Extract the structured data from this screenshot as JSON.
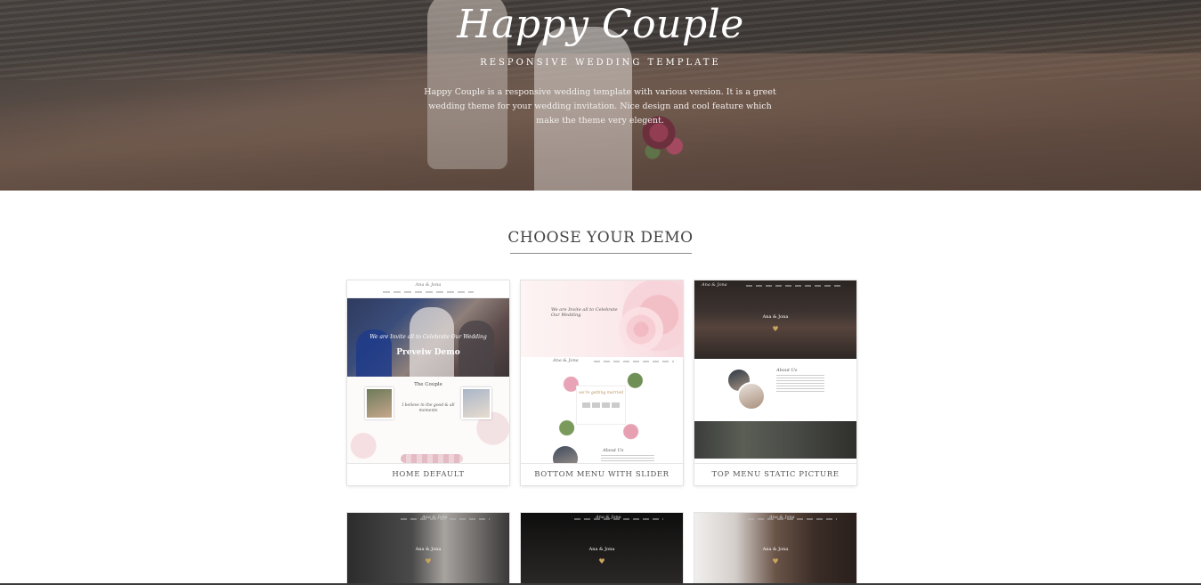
{
  "hero": {
    "title": "Happy Couple",
    "subtitle": "Responsive Wedding Template",
    "description": "Happy Couple is a responsive wedding template with various version. It is a greet wedding theme for your wedding invitation. Nice design and cool feature which make the theme very elegent."
  },
  "section": {
    "title": "CHOOSE YOUR DEMO"
  },
  "demos": [
    {
      "label": "HOME DEFAULT",
      "preview_label": "Preveiw Demo",
      "logo": "Ana & Jona",
      "hero_text": "We are Invite all to Celebrate Our Wedding",
      "couple_title": "The Couple",
      "quote": "I believe in the good & all moments"
    },
    {
      "label": "BOTTOM MENU WITH SLIDER",
      "slider_text": "We are Invite all to Celebrate Our Wedding",
      "logo": "Ana & Jona",
      "getting_married": "we're getting married",
      "about_title": "About Us"
    },
    {
      "label": "TOP MENU STATIC PICTURE",
      "logo": "Ana & Jona",
      "names": "Ana & Jona",
      "about_title": "About Us"
    }
  ],
  "demos_row2": [
    {
      "logo": "Ana & Jona",
      "names": "Ana & Jona"
    },
    {
      "logo": "Ana & Jona",
      "names": "Ana & Jona"
    },
    {
      "logo": "Ana & Jona",
      "names": "Ana & Jona"
    }
  ],
  "icons": {
    "heart": "heart-icon"
  },
  "colors": {
    "accent_gold": "#c9a55c",
    "text": "#444444",
    "underline": "#8a8a8a"
  }
}
